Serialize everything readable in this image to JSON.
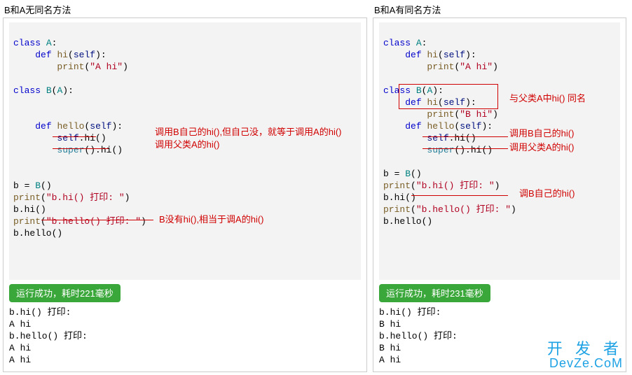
{
  "left": {
    "title": "B和A无同名方法",
    "code": {
      "A_class": "class A:",
      "A_def": "    def hi(self):",
      "A_body": "        print(\"A hi\")",
      "blank": "",
      "B_class": "class B(A):",
      "B_def": "    def hello(self):",
      "B_l1": "        self.hi()",
      "B_l2": "        super().hi()",
      "m1": "b = B()",
      "m2": "print(\"b.hi() 打印: \")",
      "m3": "b.hi()",
      "m4": "print(\"b.hello() 打印: \")",
      "m5": "b.hello()"
    },
    "anno": {
      "a1": "调用B自己的hi(),但自己没，就等于调用A的hi()",
      "a2": "调用父类A的hi()",
      "a3": "B没有hi(),相当于调A的hi()"
    },
    "success": "运行成功，耗时221毫秒",
    "output": "b.hi() 打印:\nA hi\nb.hello() 打印:\nA hi\nA hi"
  },
  "right": {
    "title": "B和A有同名方法",
    "code": {
      "A_class": "class A:",
      "A_def": "    def hi(self):",
      "A_body": "        print(\"A hi\")",
      "blank": "",
      "B_class": "class B(A):",
      "B_hi_def": "    def hi(self):",
      "B_hi_bd": "        print(\"B hi\")",
      "B_hello_def": "    def hello(self):",
      "B_l1": "        self.hi()",
      "B_l2": "        super().hi()",
      "m1": "b = B()",
      "m2": "print(\"b.hi() 打印: \")",
      "m3": "b.hi()",
      "m4": "print(\"b.hello() 打印: \")",
      "m5": "b.hello()"
    },
    "anno": {
      "a1": "与父类A中hi() 同名",
      "a2": "调用B自己的hi()",
      "a3": "调用父类A的hi()",
      "a4": "调B自己的hi()"
    },
    "success": "运行成功，耗时231毫秒",
    "output": "b.hi() 打印:\nB hi\nb.hello() 打印:\nB hi\nA hi"
  },
  "watermark": {
    "l1": "开 发 者",
    "l2": "DevZe.CoM"
  }
}
